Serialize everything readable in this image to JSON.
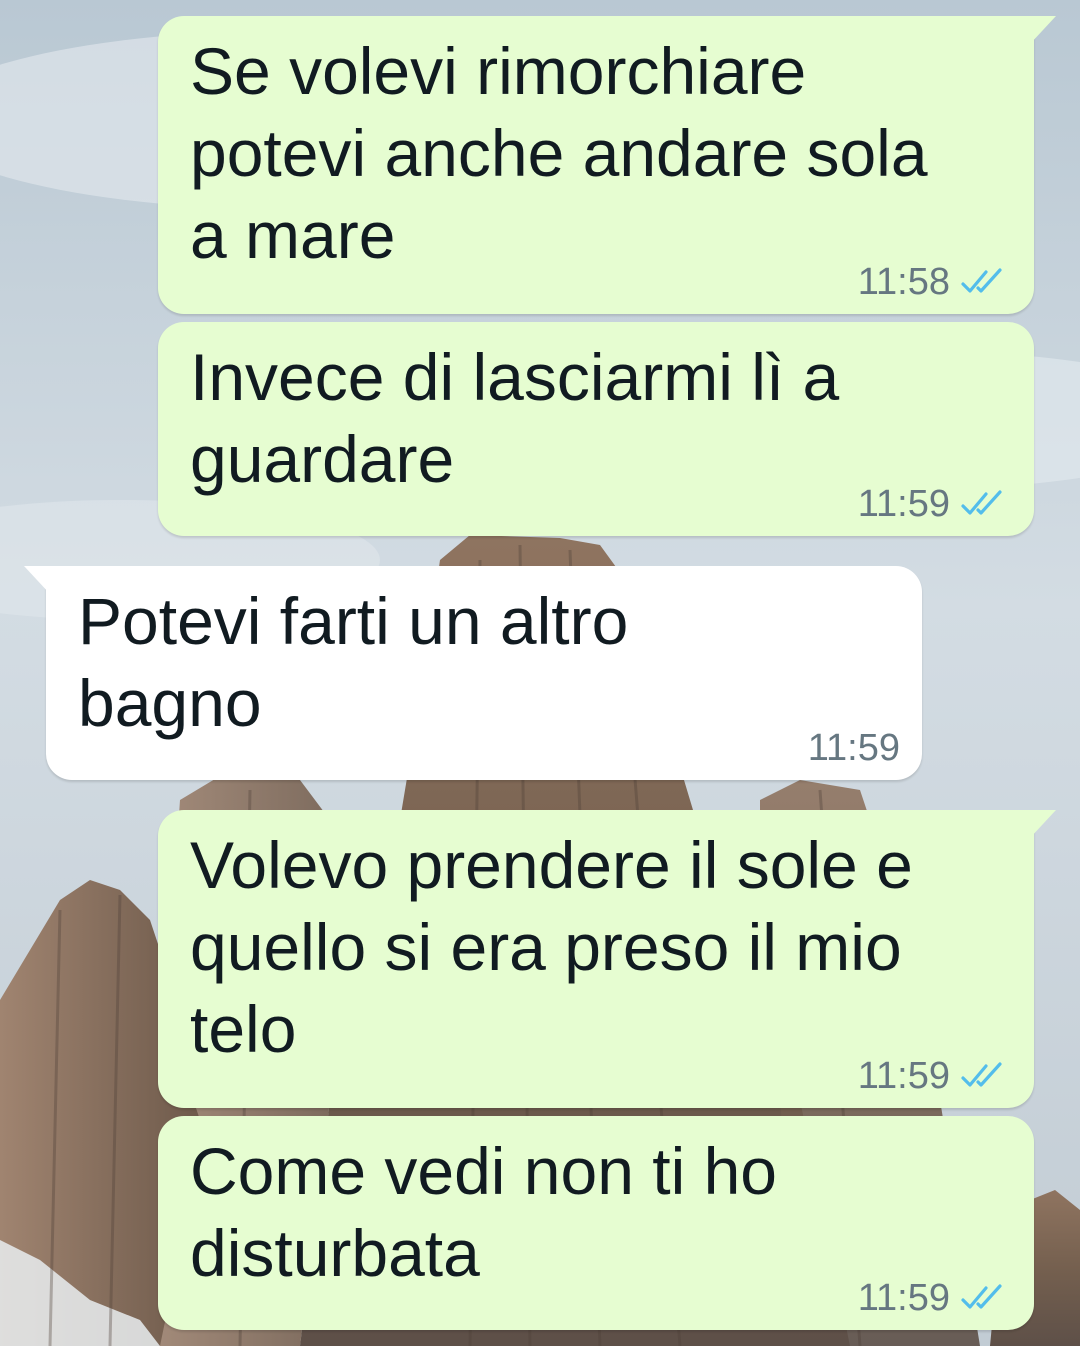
{
  "messages": [
    {
      "direction": "out",
      "lines": [
        "Se volevi rimorchiare",
        "potevi anche andare sola",
        "a mare"
      ],
      "time": "11:58",
      "status": "read-double-check-icon",
      "tail": true
    },
    {
      "direction": "out",
      "lines": [
        "Invece di lasciarmi lì a",
        "guardare"
      ],
      "time": "11:59",
      "status": "read-double-check-icon",
      "tail": false
    },
    {
      "direction": "in",
      "lines": [
        "Potevi farti un altro",
        "bagno"
      ],
      "time": "11:59",
      "tail": true
    },
    {
      "direction": "out",
      "lines": [
        "Volevo prendere il sole e",
        "quello si era preso il mio",
        "telo"
      ],
      "time": "11:59",
      "status": "read-double-check-icon",
      "tail": true
    },
    {
      "direction": "out",
      "lines": [
        "Come vedi non ti ho",
        "disturbata"
      ],
      "time": "11:59",
      "status": "read-double-check-icon",
      "tail": false
    }
  ],
  "colors": {
    "outgoing_bubble": "#e6fdd1",
    "incoming_bubble": "#ffffff",
    "read_ticks": "#53bdeb",
    "meta_text": "#667781"
  }
}
